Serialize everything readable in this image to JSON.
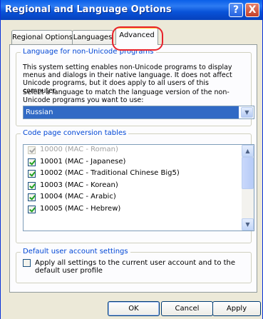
{
  "window": {
    "title": "Regional and Language Options",
    "help_label": "?",
    "close_label": "X"
  },
  "tabs": [
    {
      "label": "Regional Options",
      "active": false
    },
    {
      "label": "Languages",
      "active": false
    },
    {
      "label": "Advanced",
      "active": true
    }
  ],
  "language_group": {
    "label": "Language for non-Unicode programs",
    "description": "This system setting enables non-Unicode programs to display menus and dialogs in their native language. It does not affect Unicode programs, but it does apply to all users of this computer.",
    "select_prompt": "Select a language to match the language version of the non-Unicode programs you want to use:",
    "selected_language": "Russian",
    "dropdown_icon": "chevron-down-icon"
  },
  "codepage_group": {
    "label": "Code page conversion tables",
    "items": [
      {
        "label": "10000 (MAC - Roman)",
        "checked": true,
        "disabled": true
      },
      {
        "label": "10001 (MAC - Japanese)",
        "checked": true,
        "disabled": false
      },
      {
        "label": "10002 (MAC - Traditional Chinese Big5)",
        "checked": true,
        "disabled": false
      },
      {
        "label": "10003 (MAC - Korean)",
        "checked": true,
        "disabled": false
      },
      {
        "label": "10004 (MAC - Arabic)",
        "checked": true,
        "disabled": false
      },
      {
        "label": "10005 (MAC - Hebrew)",
        "checked": true,
        "disabled": false
      }
    ],
    "scroll_up_icon": "chevron-up-icon",
    "scroll_down_icon": "chevron-down-icon"
  },
  "default_group": {
    "label": "Default user account settings",
    "checkbox_label": "Apply all settings to the current user account and to the default user profile",
    "checked": false
  },
  "buttons": {
    "ok": "OK",
    "cancel": "Cancel",
    "apply": "Apply"
  },
  "colors": {
    "titlebar": "#0A5FE8",
    "group_label": "#0046D5",
    "selection": "#316AC5",
    "highlight_circle": "#E8212B"
  }
}
